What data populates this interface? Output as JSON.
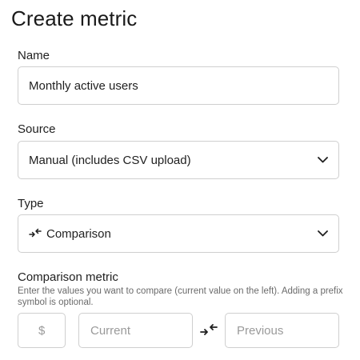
{
  "title": "Create metric",
  "name": {
    "label": "Name",
    "value": "Monthly active users"
  },
  "source": {
    "label": "Source",
    "selected": "Manual (includes CSV upload)"
  },
  "type": {
    "label": "Type",
    "selected": "Comparison",
    "icon": "compare-arrows-icon"
  },
  "comparison": {
    "label": "Comparison metric",
    "help": "Enter the values you want to compare (current value on the left). Adding a prefix symbol is optional.",
    "prefix_placeholder": "$",
    "current_placeholder": "Current",
    "previous_placeholder": "Previous"
  },
  "colors": {
    "border": "#cfcfcf",
    "text": "#1f1f1f",
    "muted": "#6b6b6b",
    "placeholder": "#9a9a9a"
  }
}
